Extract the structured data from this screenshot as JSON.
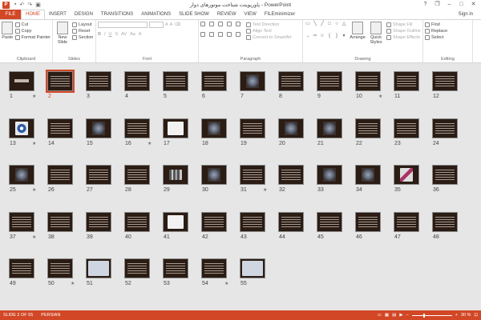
{
  "window": {
    "app_icon": "P",
    "title": "پاورپوینت شناخت موتورهای دوار - PowerPoint",
    "qat": [
      "save-icon",
      "undo-icon",
      "redo-icon",
      "start-from-beginning-icon"
    ],
    "help": "?",
    "minimize": "–",
    "restore": "❐",
    "maximize": "□",
    "close": "✕"
  },
  "tabs": {
    "file": "FILE",
    "items": [
      "HOME",
      "INSERT",
      "DESIGN",
      "TRANSITIONS",
      "ANIMATIONS",
      "SLIDE SHOW",
      "REVIEW",
      "VIEW",
      "FILEminimizer"
    ],
    "active": "HOME",
    "signin": "Sign in"
  },
  "ribbon": {
    "clipboard": {
      "paste": "Paste",
      "cut": "Cut",
      "copy": "Copy",
      "format_painter": "Format Painter",
      "label": "Clipboard"
    },
    "slides": {
      "new_slide_1": "New",
      "new_slide_2": "Slide",
      "layout": "Layout",
      "reset": "Reset",
      "section": "Section",
      "label": "Slides"
    },
    "font": {
      "bold": "B",
      "italic": "I",
      "underline": "U",
      "strike": "S",
      "label": "Font"
    },
    "paragraph": {
      "text_direction": "Text Direction",
      "align_text": "Align Text",
      "convert_smartart": "Convert to SmartArt",
      "label": "Paragraph"
    },
    "drawing": {
      "arrange": "Arrange",
      "quick_styles_1": "Quick",
      "quick_styles_2": "Styles",
      "shape_fill": "Shape Fill",
      "shape_outline": "Shape Outline",
      "shape_effects": "Shape Effects",
      "label": "Drawing"
    },
    "editing": {
      "find": "Find",
      "replace": "Replace",
      "select": "Select",
      "label": "Editing"
    }
  },
  "slides": [
    {
      "n": "1",
      "kind": "title",
      "star": true
    },
    {
      "n": "2",
      "kind": "text",
      "star": false,
      "selected": true
    },
    {
      "n": "3",
      "kind": "text",
      "star": false
    },
    {
      "n": "4",
      "kind": "text",
      "star": false
    },
    {
      "n": "5",
      "kind": "text",
      "star": false
    },
    {
      "n": "6",
      "kind": "text",
      "star": false
    },
    {
      "n": "7",
      "kind": "pic",
      "star": false
    },
    {
      "n": "8",
      "kind": "text",
      "star": false
    },
    {
      "n": "9",
      "kind": "text",
      "star": false
    },
    {
      "n": "10",
      "kind": "text",
      "star": true
    },
    {
      "n": "11",
      "kind": "text",
      "star": false
    },
    {
      "n": "12",
      "kind": "text",
      "star": false
    },
    {
      "n": "13",
      "kind": "blue",
      "star": true
    },
    {
      "n": "14",
      "kind": "text",
      "star": false
    },
    {
      "n": "15",
      "kind": "pic",
      "star": false
    },
    {
      "n": "16",
      "kind": "text",
      "star": true
    },
    {
      "n": "17",
      "kind": "white",
      "star": false
    },
    {
      "n": "18",
      "kind": "pic",
      "star": false
    },
    {
      "n": "19",
      "kind": "text",
      "star": false
    },
    {
      "n": "20",
      "kind": "pic",
      "star": false
    },
    {
      "n": "21",
      "kind": "pic",
      "star": false
    },
    {
      "n": "22",
      "kind": "text",
      "star": false
    },
    {
      "n": "23",
      "kind": "text",
      "star": false
    },
    {
      "n": "24",
      "kind": "text",
      "star": false
    },
    {
      "n": "25",
      "kind": "pic",
      "star": true
    },
    {
      "n": "26",
      "kind": "text",
      "star": false
    },
    {
      "n": "27",
      "kind": "text",
      "star": false
    },
    {
      "n": "28",
      "kind": "text",
      "star": false
    },
    {
      "n": "29",
      "kind": "row",
      "star": false
    },
    {
      "n": "30",
      "kind": "pic",
      "star": false
    },
    {
      "n": "31",
      "kind": "text",
      "star": true
    },
    {
      "n": "32",
      "kind": "text",
      "star": false
    },
    {
      "n": "33",
      "kind": "pic",
      "star": false
    },
    {
      "n": "34",
      "kind": "pic",
      "star": false
    },
    {
      "n": "35",
      "kind": "tri",
      "star": false
    },
    {
      "n": "36",
      "kind": "text",
      "star": false
    },
    {
      "n": "37",
      "kind": "text",
      "star": true
    },
    {
      "n": "38",
      "kind": "text",
      "star": false
    },
    {
      "n": "39",
      "kind": "text",
      "star": false
    },
    {
      "n": "40",
      "kind": "text",
      "star": false
    },
    {
      "n": "41",
      "kind": "white",
      "star": false
    },
    {
      "n": "42",
      "kind": "text",
      "star": false
    },
    {
      "n": "43",
      "kind": "text",
      "star": false
    },
    {
      "n": "44",
      "kind": "text",
      "star": false
    },
    {
      "n": "45",
      "kind": "text",
      "star": false
    },
    {
      "n": "46",
      "kind": "text",
      "star": false
    },
    {
      "n": "47",
      "kind": "text",
      "star": false
    },
    {
      "n": "48",
      "kind": "text",
      "star": false
    },
    {
      "n": "49",
      "kind": "text",
      "star": false
    },
    {
      "n": "50",
      "kind": "text",
      "star": true
    },
    {
      "n": "51",
      "kind": "screen",
      "star": false
    },
    {
      "n": "52",
      "kind": "text",
      "star": false
    },
    {
      "n": "53",
      "kind": "text",
      "star": false
    },
    {
      "n": "54",
      "kind": "text",
      "star": true
    },
    {
      "n": "55",
      "kind": "screen",
      "star": false
    }
  ],
  "star_glyph": "★",
  "status": {
    "slide_info": "SLIDE 2 OF 55",
    "language": "PERSIAN",
    "zoom": "30 %",
    "zoom_minus": "–",
    "zoom_plus": "+",
    "zoom_level": 0.3
  },
  "colors": {
    "accent": "#d24726",
    "selection": "#d24726"
  }
}
